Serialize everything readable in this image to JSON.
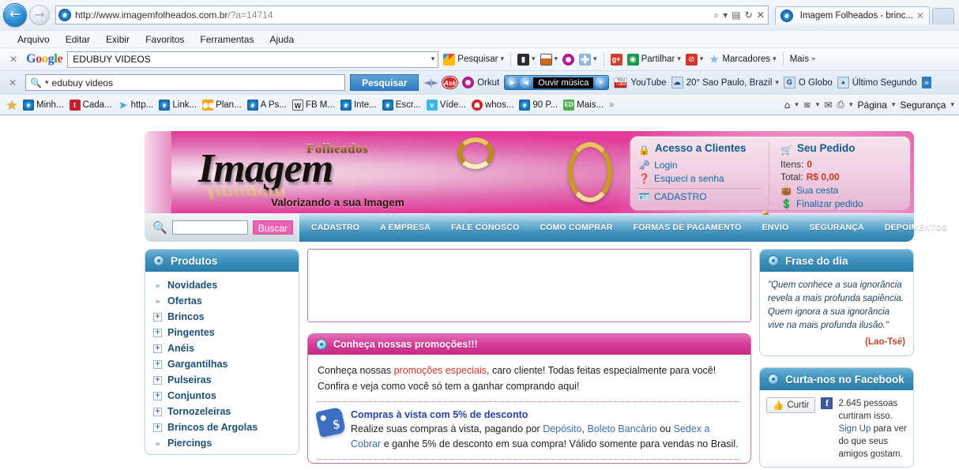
{
  "browser": {
    "url_main": "http://www.imagemfolheados.com.br",
    "url_query": "/?a=14714",
    "tab_title": "Imagem Folheados - brinc...",
    "tab_close": "✕",
    "url_icons": [
      "⌕",
      "▾",
      "▤",
      "↻",
      "✕"
    ],
    "menu": [
      "Arquivo",
      "Editar",
      "Exibir",
      "Favoritos",
      "Ferramentas",
      "Ajuda"
    ],
    "back_arrow": "←",
    "forward_arrow": "→"
  },
  "google_toolbar": {
    "close": "✕",
    "logo": [
      "G",
      "o",
      "o",
      "g",
      "l",
      "e"
    ],
    "search_value": "EDUBUY VIDEOS",
    "search_button": "Pesquisar",
    "items": [
      {
        "label": "Pesquisar",
        "icon": "google-quad-icon",
        "caret": "▾"
      },
      {
        "label": "",
        "icon": "bookmark-icon",
        "caret": "▾"
      },
      {
        "label": "",
        "icon": "window-icon",
        "caret": "▾"
      },
      {
        "label": "",
        "icon": "orkut-icon",
        "caret": ""
      },
      {
        "label": "",
        "icon": "plus-icon",
        "caret": "▾"
      },
      {
        "label": "",
        "icon": "google-plus-icon",
        "caret": ""
      },
      {
        "label": "Partilhar",
        "icon": "share-icon",
        "caret": "▾"
      },
      {
        "label": "",
        "icon": "block-icon",
        "caret": "▾"
      },
      {
        "label": "Marcadores",
        "icon": "star-icon",
        "caret": "▾"
      },
      {
        "label": "Mais",
        "icon": "",
        "caret": "»"
      }
    ]
  },
  "ask_toolbar": {
    "close": "✕",
    "search_value": "edubuy videos",
    "search_button": "Pesquisar",
    "ask_label": "Ask",
    "items": [
      {
        "label": "Orkut",
        "icon": "orkut-icon"
      },
      {
        "label": "YouTube",
        "icon": "youtube-icon"
      },
      {
        "label": "20° Sao Paulo, Brazil",
        "icon": "weather-icon",
        "caret": "▾"
      },
      {
        "label": "O Globo",
        "icon": "globo-icon"
      },
      {
        "label": "Último Segundo",
        "icon": "ultimo-segundo-icon"
      }
    ],
    "player_label": "Ouvir música",
    "player_play": "▶",
    "player_vol": "◀",
    "player_caret": "▾",
    "overflow": "»"
  },
  "favorites_bar": {
    "items": [
      {
        "label": "",
        "icon": "favorites-star-icon"
      },
      {
        "label": "Minh...",
        "icon": "ie-page-icon"
      },
      {
        "label": "Cada...",
        "icon": "red-tile-icon"
      },
      {
        "label": "http...",
        "icon": "twitter-bird-icon"
      },
      {
        "label": "Link...",
        "icon": "ie-page-icon"
      },
      {
        "label": "Plan...",
        "icon": "eyes-icon"
      },
      {
        "label": "A Ps...",
        "icon": "ie-page-icon"
      },
      {
        "label": "FB M...",
        "icon": "fb-tile-icon"
      },
      {
        "label": "Inte...",
        "icon": "ie-page-icon"
      },
      {
        "label": "Escr...",
        "icon": "ie-page-icon"
      },
      {
        "label": "Víde...",
        "icon": "vimeo-icon"
      },
      {
        "label": "whos...",
        "icon": "whos-icon"
      },
      {
        "label": "90 P...",
        "icon": "ie-page-icon"
      },
      {
        "label": "Mais...",
        "icon": "ed-icon"
      }
    ],
    "overflow": "»",
    "commands": [
      {
        "name": "home-icon",
        "glyph": "⌂",
        "caret": "▾"
      },
      {
        "name": "feeds-icon",
        "glyph": "📶",
        "caret": "▾"
      },
      {
        "name": "mail-icon",
        "glyph": "✉",
        "caret": ""
      },
      {
        "name": "print-icon",
        "glyph": "🖶",
        "caret": "▾"
      }
    ],
    "page_menu": "Página",
    "security_menu": "Segurança",
    "page_caret": "▾",
    "security_caret": "▾"
  },
  "site": {
    "logo": {
      "sup": "Folheados",
      "main": "Imagem",
      "tagline": "Valorizando a sua Imagem"
    },
    "account": {
      "clients_title": "Acesso a Clientes",
      "login": "Login",
      "forgot": "Esqueci a senha",
      "register": "CADASTRO",
      "order_title": "Seu Pedido",
      "items_label": "Itens:",
      "items_value": "0",
      "total_label": "Total:",
      "total_value": "R$ 0,00",
      "cart": "Sua cesta",
      "checkout": "Finalizar pedido"
    },
    "nav": {
      "search_value": "",
      "search_button": "Buscar",
      "links": [
        "CADASTRO",
        "A EMPRESA",
        "FALE CONOSCO",
        "COMO COMPRAR",
        "FORMAS DE PAGAMENTO",
        "ENVIO",
        "SEGURANÇA",
        "DEPOIMENTOS"
      ]
    },
    "sidebar": {
      "title": "Produtos",
      "items": [
        {
          "label": "Novidades",
          "marker": "»"
        },
        {
          "label": "Ofertas",
          "marker": "»"
        },
        {
          "label": "Brincos",
          "marker": "+"
        },
        {
          "label": "Pingentes",
          "marker": "+"
        },
        {
          "label": "Anéis",
          "marker": "+"
        },
        {
          "label": "Gargantilhas",
          "marker": "+"
        },
        {
          "label": "Pulseiras",
          "marker": "+"
        },
        {
          "label": "Conjuntos",
          "marker": "+"
        },
        {
          "label": "Tornozeleiras",
          "marker": "+"
        },
        {
          "label": "Brincos de Argolas",
          "marker": "+"
        },
        {
          "label": "Piercings",
          "marker": "»"
        }
      ]
    },
    "promo": {
      "header": "Conheça nossas promoções!!!",
      "text_a": "Conheça nossas ",
      "link": "promoções especiais",
      "text_b": ", caro cliente! Todas feitas especialmente para você! Confira e veja como você só tem a ganhar comprando aqui!",
      "offer_title": "Compras à vista com 5% de desconto",
      "offer_a": "Realize suas compras à vista, pagando por ",
      "offer_l1": "Depósito",
      "offer_sep1": ", ",
      "offer_l2": "Boleto Bancário",
      "offer_sep2": " ou ",
      "offer_l3": "Sedex a Cobrar",
      "offer_b": " e ganhe 5% de desconto em sua compra! Válido somente para vendas no Brasil."
    },
    "quote_panel": {
      "title": "Frase do dia",
      "text": "\"Quem conhece a sua ignorância revela a mais profunda sapiência. Quem ignora a sua ignorância vive na mais profunda ilusão.\"",
      "author": "(Lao-Tsé)"
    },
    "facebook_panel": {
      "title": "Curta-nos no Facebook",
      "like_label": "Curtir",
      "like_icon": "👍",
      "fb_glyph": "f",
      "count_text": "2.645 pessoas curtiram isso. ",
      "signup": "Sign Up",
      "tail_text": " para ver do que seus amigos gostam."
    }
  },
  "colors": {
    "pink": "#d8399a",
    "blue": "#2b7ea8",
    "link_blue": "#3a6ea8",
    "red": "#c8372a"
  }
}
